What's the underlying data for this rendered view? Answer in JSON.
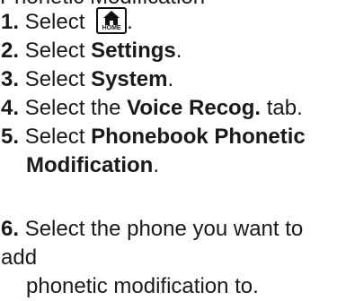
{
  "clipped_heading": "Phonetic Modification",
  "steps": [
    {
      "num": "1.",
      "pre": "Select",
      "icon": "home-icon",
      "icon_label": "HOME",
      "post": "."
    },
    {
      "num": "2.",
      "pre": "Select ",
      "bold": "Settings",
      "post": "."
    },
    {
      "num": "3.",
      "pre": "Select ",
      "bold": "System",
      "post": "."
    },
    {
      "num": "4.",
      "pre": "Select the ",
      "bold": "Voice Recog.",
      "post": " tab."
    },
    {
      "num": "5.",
      "pre": "Select ",
      "bold_line1": "Phonebook Phonetic",
      "bold_line2": "Modification",
      "post": "."
    },
    {
      "num": "6.",
      "line1": "Select the phone you want to add",
      "line2": "phonetic modification to."
    }
  ]
}
